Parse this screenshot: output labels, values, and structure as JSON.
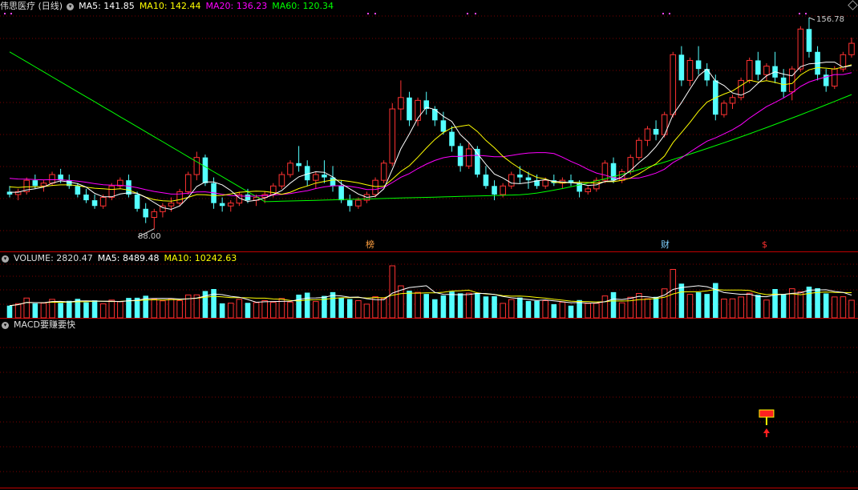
{
  "header": {
    "stock_name": "伟思医疗 (日线)",
    "ma5": "MA5: 141.85",
    "ma10": "MA10: 142.44",
    "ma20": "MA20: 136.23",
    "ma60": "MA60: 120.34"
  },
  "price_annotations": {
    "high": "156.78",
    "low": "88.00"
  },
  "event_markers": [
    {
      "text": "榜",
      "color": "#ffa040"
    },
    {
      "text": "财",
      "color": "#7fd0ff"
    },
    {
      "text": "$",
      "color": "#ff3030"
    }
  ],
  "volume_header": {
    "volume": "VOLUME: 2820.47",
    "ma5": "MA5: 8489.48",
    "ma10": "MA10: 10242.63"
  },
  "indicator_header": {
    "title": "MACD要赚要快"
  },
  "colors": {
    "up": "#ff3232",
    "down": "#54ffff",
    "ma5": "#ffffff",
    "ma10": "#ffff00",
    "ma20": "#ff00ff",
    "ma60": "#00ff00",
    "grid": "#7a0000"
  },
  "chart_data": {
    "type": "candlestick",
    "ohlc": [
      [
        101,
        103,
        99,
        100
      ],
      [
        100,
        102,
        98,
        101
      ],
      [
        101,
        106,
        100,
        105
      ],
      [
        105,
        107,
        102,
        103
      ],
      [
        103,
        105,
        101,
        104
      ],
      [
        104,
        108,
        103,
        107
      ],
      [
        107,
        109,
        104,
        105
      ],
      [
        105,
        107,
        102,
        103
      ],
      [
        103,
        104,
        99,
        100
      ],
      [
        100,
        102,
        97,
        98
      ],
      [
        98,
        100,
        95,
        96
      ],
      [
        96,
        100,
        95,
        99
      ],
      [
        99,
        104,
        98,
        103
      ],
      [
        103,
        106,
        102,
        105
      ],
      [
        105,
        107,
        99,
        100
      ],
      [
        100,
        101,
        94,
        95
      ],
      [
        95,
        97,
        90,
        92
      ],
      [
        92,
        95,
        88,
        94
      ],
      [
        94,
        97,
        92,
        96
      ],
      [
        96,
        99,
        94,
        97
      ],
      [
        97,
        102,
        96,
        101
      ],
      [
        101,
        108,
        100,
        107
      ],
      [
        107,
        115,
        105,
        113
      ],
      [
        113,
        114,
        103,
        104
      ],
      [
        104,
        106,
        95,
        97
      ],
      [
        97,
        99,
        94,
        96
      ],
      [
        96,
        98,
        94,
        97
      ],
      [
        97,
        101,
        96,
        100
      ],
      [
        100,
        102,
        97,
        98
      ],
      [
        98,
        100,
        96,
        99
      ],
      [
        99,
        101,
        97,
        100
      ],
      [
        100,
        104,
        99,
        103
      ],
      [
        103,
        108,
        102,
        107
      ],
      [
        107,
        112,
        106,
        111
      ],
      [
        111,
        117,
        108,
        110
      ],
      [
        110,
        112,
        103,
        105
      ],
      [
        105,
        108,
        102,
        107
      ],
      [
        107,
        112,
        104,
        106
      ],
      [
        106,
        110,
        101,
        103
      ],
      [
        103,
        105,
        97,
        98
      ],
      [
        98,
        100,
        94,
        96
      ],
      [
        96,
        99,
        95,
        98
      ],
      [
        98,
        101,
        97,
        100
      ],
      [
        100,
        106,
        99,
        105
      ],
      [
        105,
        112,
        104,
        111
      ],
      [
        111,
        132,
        110,
        130
      ],
      [
        130,
        140,
        126,
        134
      ],
      [
        134,
        136,
        124,
        126
      ],
      [
        126,
        134,
        124,
        133
      ],
      [
        133,
        136,
        128,
        130
      ],
      [
        130,
        131,
        124,
        126
      ],
      [
        126,
        129,
        121,
        122
      ],
      [
        122,
        124,
        115,
        117
      ],
      [
        117,
        118,
        108,
        110
      ],
      [
        110,
        118,
        109,
        116
      ],
      [
        116,
        117,
        106,
        107
      ],
      [
        107,
        110,
        102,
        103
      ],
      [
        103,
        105,
        98,
        100
      ],
      [
        100,
        104,
        99,
        103
      ],
      [
        103,
        108,
        102,
        107
      ],
      [
        107,
        110,
        104,
        106
      ],
      [
        106,
        108,
        102,
        105
      ],
      [
        105,
        107,
        102,
        103
      ],
      [
        103,
        106,
        102,
        105
      ],
      [
        105,
        107,
        103,
        104
      ],
      [
        104,
        106,
        102,
        105
      ],
      [
        105,
        107,
        103,
        104
      ],
      [
        104,
        105,
        99,
        101
      ],
      [
        101,
        103,
        100,
        102
      ],
      [
        102,
        106,
        101,
        105
      ],
      [
        105,
        112,
        104,
        111
      ],
      [
        111,
        113,
        104,
        105
      ],
      [
        105,
        109,
        104,
        108
      ],
      [
        108,
        114,
        107,
        113
      ],
      [
        113,
        120,
        112,
        119
      ],
      [
        119,
        124,
        117,
        123
      ],
      [
        123,
        126,
        119,
        121
      ],
      [
        121,
        129,
        120,
        128
      ],
      [
        128,
        150,
        127,
        149
      ],
      [
        149,
        152,
        138,
        140
      ],
      [
        140,
        148,
        138,
        147
      ],
      [
        147,
        152,
        142,
        144
      ],
      [
        144,
        146,
        138,
        140
      ],
      [
        140,
        142,
        126,
        128
      ],
      [
        128,
        133,
        127,
        132
      ],
      [
        132,
        135,
        130,
        134
      ],
      [
        134,
        141,
        133,
        140
      ],
      [
        140,
        148,
        139,
        147
      ],
      [
        147,
        150,
        140,
        142
      ],
      [
        142,
        146,
        140,
        145
      ],
      [
        145,
        150,
        139,
        141
      ],
      [
        141,
        144,
        134,
        136
      ],
      [
        136,
        145,
        133,
        144
      ],
      [
        144,
        159,
        143,
        158
      ],
      [
        158,
        162,
        148,
        150
      ],
      [
        150,
        152,
        140,
        142
      ],
      [
        142,
        144,
        136,
        138
      ],
      [
        138,
        145,
        137,
        144
      ],
      [
        144,
        150,
        143,
        149
      ],
      [
        149,
        155,
        148,
        153
      ]
    ],
    "ma5": [],
    "ma10": [],
    "ma20": [],
    "ma60": [],
    "volume": [],
    "signal_marker_index": 89
  }
}
